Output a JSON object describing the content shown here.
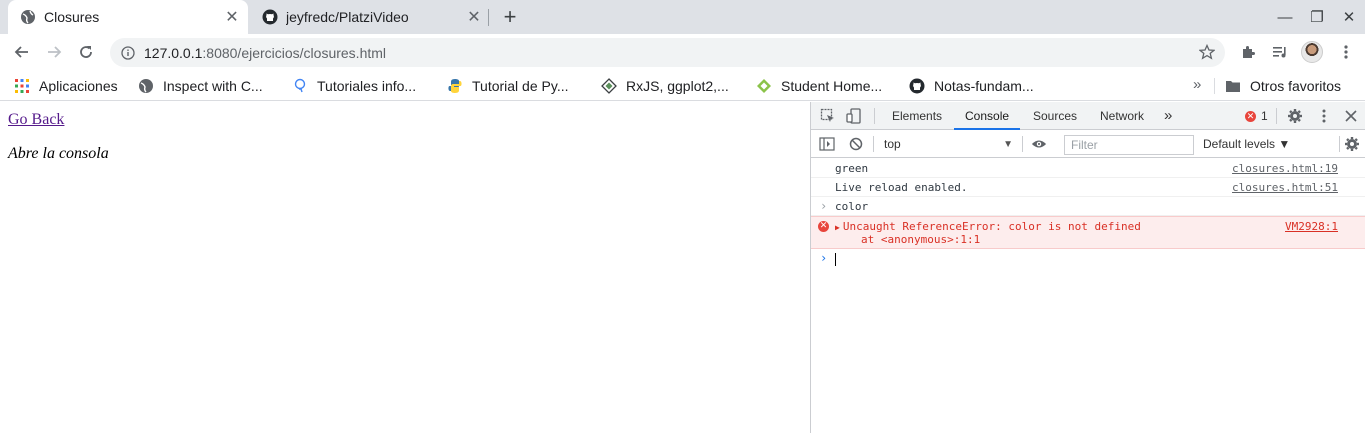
{
  "browser": {
    "tabs": [
      {
        "title": "Closures",
        "active": true,
        "icon": "globe-icon"
      },
      {
        "title": "jeyfredc/PlatziVideo",
        "active": false,
        "icon": "github-icon"
      }
    ],
    "new_tab_label": "+",
    "address_bar": {
      "host": "127.0.0.1",
      "path": ":8080/ejercicios/closures.html"
    },
    "bookmarks": [
      {
        "label": "Aplicaciones",
        "icon": "apps-grid-icon"
      },
      {
        "label": "Inspect with C...",
        "icon": "globe-icon"
      },
      {
        "label": "Tutoriales info...",
        "icon": "bulb-icon"
      },
      {
        "label": "Tutorial de Py...",
        "icon": "python-icon"
      },
      {
        "label": "RxJS, ggplot2,...",
        "icon": "diamond-icon"
      },
      {
        "label": "Student Home...",
        "icon": "leaf-diamond-icon"
      },
      {
        "label": "Notas-fundam...",
        "icon": "github-icon"
      }
    ],
    "bookmarks_more": "»",
    "other_bookmarks": "Otros favoritos"
  },
  "page": {
    "go_back_link": "Go Back",
    "note": "Abre la consola"
  },
  "devtools": {
    "tabs": [
      "Elements",
      "Console",
      "Sources",
      "Network"
    ],
    "active_tab": "Console",
    "more_tabs": "»",
    "error_count": "1",
    "context": "top",
    "filter_placeholder": "Filter",
    "levels": "Default levels ▼",
    "messages": [
      {
        "type": "log",
        "text": "green",
        "source": "closures.html:19"
      },
      {
        "type": "log",
        "text": "Live reload enabled.",
        "source": "closures.html:51"
      },
      {
        "type": "input",
        "text": "color"
      },
      {
        "type": "error",
        "text": "Uncaught ReferenceError: color is not defined",
        "stack": "at <anonymous>:1:1",
        "source": "VM2928:1"
      }
    ],
    "colors": {
      "accent": "#1a73e8",
      "error": "#d93025",
      "error_bg": "#fdeded"
    }
  }
}
